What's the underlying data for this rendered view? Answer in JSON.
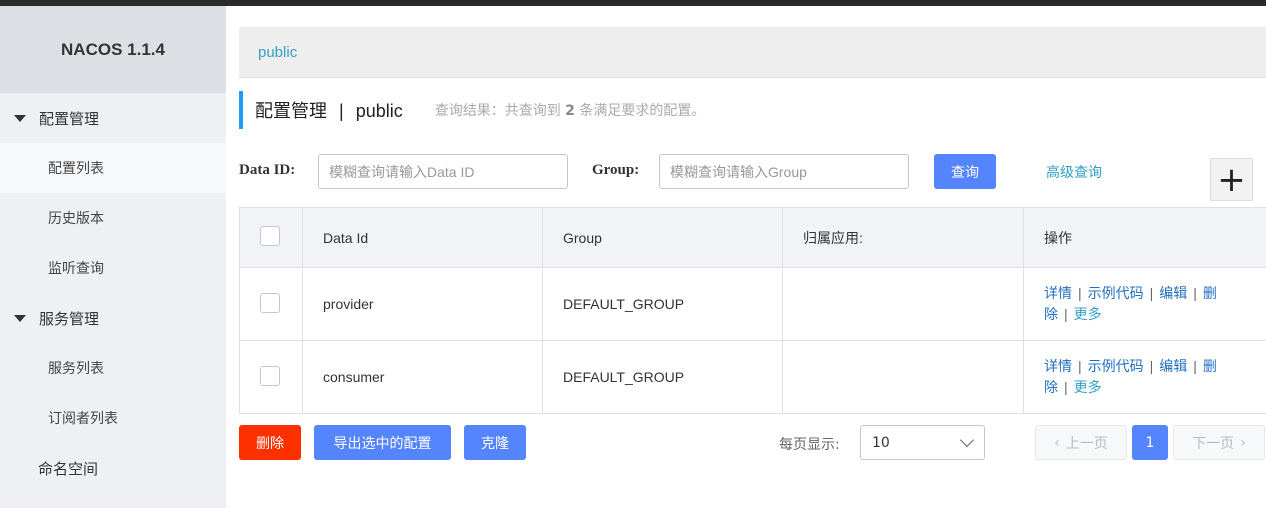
{
  "app": {
    "title": "NACOS 1.1.4"
  },
  "sidebar": {
    "groups": [
      {
        "label": "配置管理",
        "items": [
          "配置列表",
          "历史版本",
          "监听查询"
        ]
      },
      {
        "label": "服务管理",
        "items": [
          "服务列表",
          "订阅者列表"
        ]
      }
    ],
    "namespace_label": "命名空间"
  },
  "namespace_bar": {
    "current": "public"
  },
  "page": {
    "title": "配置管理",
    "separator": "|",
    "namespace": "public",
    "result_prefix": "查询结果：共查询到",
    "result_count": "2",
    "result_suffix": "条满足要求的配置。"
  },
  "search": {
    "dataid_label": "Data ID:",
    "dataid_placeholder": "模糊查询请输入Data ID",
    "group_label": "Group:",
    "group_placeholder": "模糊查询请输入Group",
    "query_button": "查询",
    "advanced_link": "高级查询",
    "add_symbol": "+"
  },
  "table": {
    "headers": [
      "Data Id",
      "Group",
      "归属应用:",
      "操作"
    ],
    "rows": [
      {
        "data_id": "provider",
        "group": "DEFAULT_GROUP",
        "app": ""
      },
      {
        "data_id": "consumer",
        "group": "DEFAULT_GROUP",
        "app": ""
      }
    ],
    "actions": {
      "detail": "详情",
      "sample": "示例代码",
      "edit": "编辑",
      "delete_part1": "删",
      "delete_part2": "除",
      "more": "更多",
      "pipe": "|"
    }
  },
  "footer": {
    "delete_button": "删除",
    "export_button": "导出选中的配置",
    "clone_button": "克隆",
    "page_size_label": "每页显示:",
    "page_size": "10",
    "prev_button": "上一页",
    "current_page": "1",
    "next_button": "下一页"
  },
  "colors": {
    "accent": "#209bfa",
    "primary": "#5584ff",
    "danger": "#ff3000",
    "link": "#33a0c8"
  }
}
